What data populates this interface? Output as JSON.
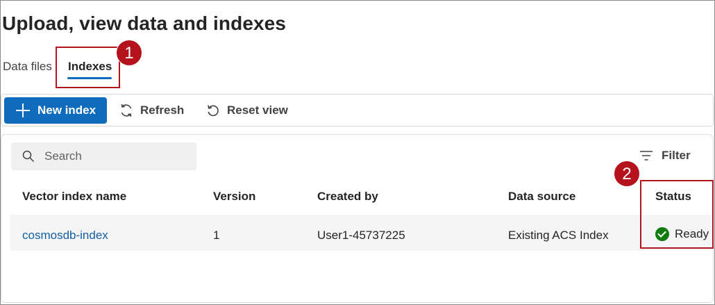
{
  "page": {
    "title": "Upload, view data and indexes"
  },
  "tabs": [
    {
      "label": "Data files",
      "selected": false
    },
    {
      "label": "Indexes",
      "selected": true
    }
  ],
  "callouts": [
    "1",
    "2"
  ],
  "toolbar": {
    "new_index_label": "New index",
    "refresh_label": "Refresh",
    "reset_view_label": "Reset view"
  },
  "search": {
    "placeholder": "Search"
  },
  "filter": {
    "label": "Filter"
  },
  "table": {
    "columns": [
      "Vector index name",
      "Version",
      "Created by",
      "Data source",
      "Status"
    ],
    "rows": [
      {
        "name": "cosmosdb-index",
        "version": "1",
        "created_by": "User1-45737225",
        "data_source": "Existing ACS Index",
        "status": "Ready"
      }
    ]
  },
  "colors": {
    "accent": "#0f6cbd",
    "callout": "#b4131d",
    "status_ready": "#107c10",
    "link": "#115ea3"
  },
  "icons": {
    "new_index": "plus-icon",
    "refresh": "refresh-icon",
    "reset_view": "undo-icon",
    "search": "search-icon",
    "filter": "filter-icon",
    "status": "checkmark-circle-icon"
  }
}
